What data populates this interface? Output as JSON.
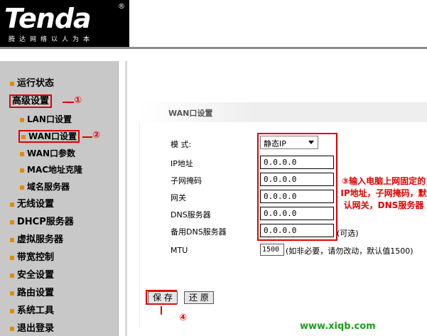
{
  "brand": {
    "name": "Tenda",
    "reg": "®",
    "tagline": "腾达网络以人为本"
  },
  "sidebar": {
    "items": [
      {
        "label": "运行状态"
      },
      {
        "label": "高级设置"
      },
      {
        "label": "LAN口设置"
      },
      {
        "label": "WAN口设置"
      },
      {
        "label": "WAN口参数"
      },
      {
        "label": "MAC地址克隆"
      },
      {
        "label": "域名服务器"
      },
      {
        "label": "无线设置"
      },
      {
        "label": "DHCP服务器"
      },
      {
        "label": "虚拟服务器"
      },
      {
        "label": "带宽控制"
      },
      {
        "label": "安全设置"
      },
      {
        "label": "路由设置"
      },
      {
        "label": "系统工具"
      },
      {
        "label": "退出登录"
      }
    ],
    "callout_1": "①",
    "callout_2": "②"
  },
  "panel": {
    "title": "WAN口设置",
    "mode_label": "模  式:",
    "mode_value": "静态IP",
    "fields": [
      {
        "label": "IP地址",
        "value": "0.0.0.0"
      },
      {
        "label": "子网掩码",
        "value": "0.0.0.0"
      },
      {
        "label": "网关",
        "value": "0.0.0.0"
      },
      {
        "label": "DNS服务器",
        "value": "0.0.0.0"
      },
      {
        "label": "备用DNS服务器",
        "value": "0.0.0.0"
      }
    ],
    "optional": "(可选)",
    "mtu_label": "MTU",
    "mtu_value": "1500",
    "mtu_hint": "(如非必要，请勿改动，默认值1500)",
    "note": "③输入电脑上网固定的IP地址，子网掩码，默认网关，DNS服务器",
    "save_label": "保 存",
    "reset_label": "还 原",
    "callout_4": "④"
  },
  "watermark": "www.xiqb.com",
  "colors": {
    "accent_red": "#e00000",
    "sidebar_bg": "#c8c8c8",
    "bullet": "#e08a00",
    "watermark": "#1aa01a"
  }
}
